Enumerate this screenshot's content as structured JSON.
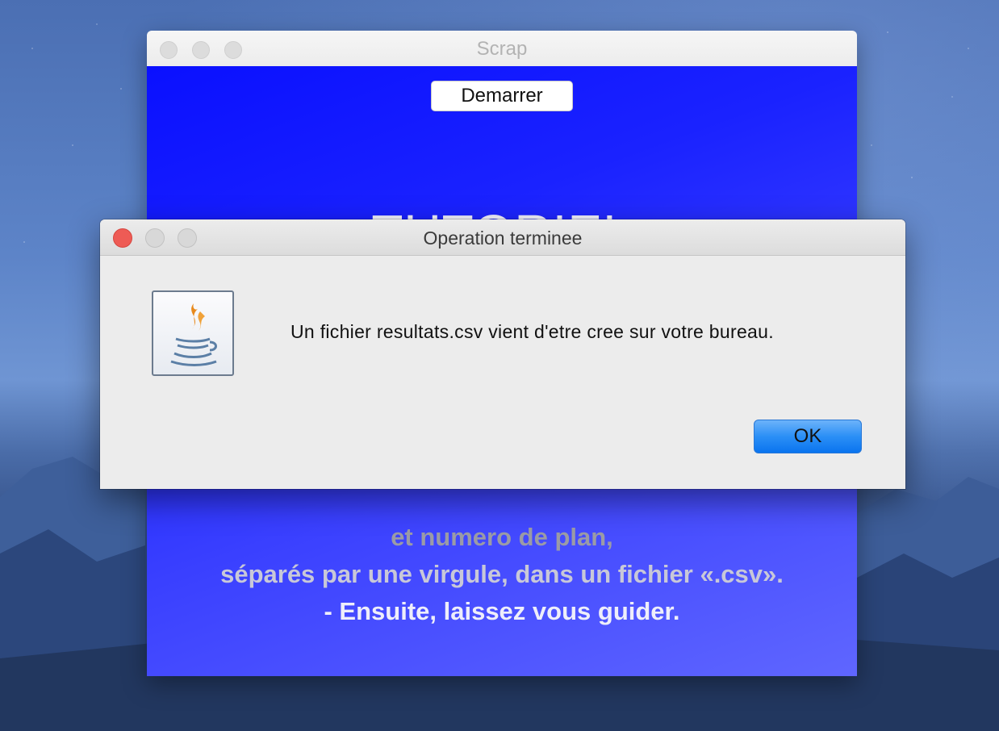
{
  "scrap_window": {
    "title": "Scrap",
    "start_button_label": "Demarrer",
    "heading": "TUTORIEL",
    "lines": [
      "et numero de plan,",
      "séparés par une virgule, dans un fichier «.csv».",
      "- Ensuite, laissez vous guider."
    ]
  },
  "dialog": {
    "title": "Operation terminee",
    "message": "Un fichier resultats.csv vient d'etre cree sur votre bureau.",
    "ok_label": "OK",
    "icon": "java-icon"
  },
  "colors": {
    "scrap_background": "#1a22ff",
    "ok_button": "#2b8ff6",
    "close_button": "#ee5b55"
  }
}
